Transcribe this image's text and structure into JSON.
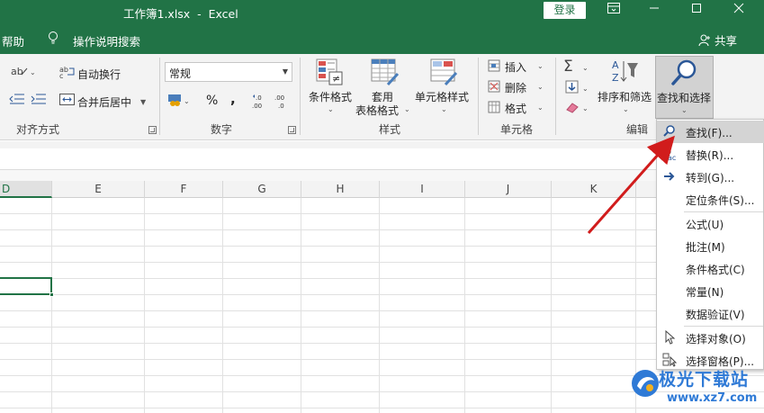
{
  "titlebar": {
    "document_title": "工作簿1.xlsx  -  Excel",
    "login_label": "登录",
    "ribbon_display_icon": "ribbon-display-options-icon",
    "minimize_icon": "minimize-icon",
    "maximize_icon": "maximize-icon",
    "close_icon": "close-icon"
  },
  "tellbar": {
    "help_tab": "帮助",
    "tell_me_label": "操作说明搜索",
    "share_label": "共享"
  },
  "ribbon": {
    "alignment": {
      "wrap_text": "自动换行",
      "merge_center": "合并后居中",
      "group_label": "对齐方式"
    },
    "number": {
      "format_value": "常规",
      "percent": "%",
      "comma": ",",
      "group_label": "数字"
    },
    "styles": {
      "conditional_format": "条件格式",
      "format_table_line1": "套用",
      "format_table_line2": "表格格式",
      "cell_styles": "单元格样式",
      "group_label": "样式"
    },
    "cells": {
      "insert": "插入",
      "delete": "删除",
      "format": "格式",
      "group_label": "单元格"
    },
    "editing": {
      "sort_filter": "排序和筛选",
      "find_select": "查找和选择",
      "group_label": "编辑"
    }
  },
  "grid": {
    "columns": [
      "D",
      "E",
      "F",
      "G",
      "H",
      "I",
      "J",
      "K"
    ],
    "active_column": "D"
  },
  "find_menu": {
    "items": [
      {
        "label": "查找(F)...",
        "icon": "magnifier-icon"
      },
      {
        "label": "替换(R)...",
        "icon": "replace-icon"
      },
      {
        "label": "转到(G)...",
        "icon": "arrow-right-icon"
      },
      {
        "label": "定位条件(S)...",
        "icon": ""
      },
      {
        "label": "公式(U)",
        "icon": ""
      },
      {
        "label": "批注(M)",
        "icon": ""
      },
      {
        "label": "条件格式(C)",
        "icon": ""
      },
      {
        "label": "常量(N)",
        "icon": ""
      },
      {
        "label": "数据验证(V)",
        "icon": ""
      },
      {
        "label": "选择对象(O)",
        "icon": "pointer-icon"
      },
      {
        "label": "选择窗格(P)...",
        "icon": "selection-pane-icon"
      }
    ],
    "highlighted": "查找(F)..."
  },
  "watermark": {
    "name": "极光下载站",
    "url": "www.xz7.com"
  },
  "colors": {
    "excel_green": "#217346",
    "annotation_arrow": "#d11c1c",
    "watermark_blue": "#2f7ad6"
  }
}
